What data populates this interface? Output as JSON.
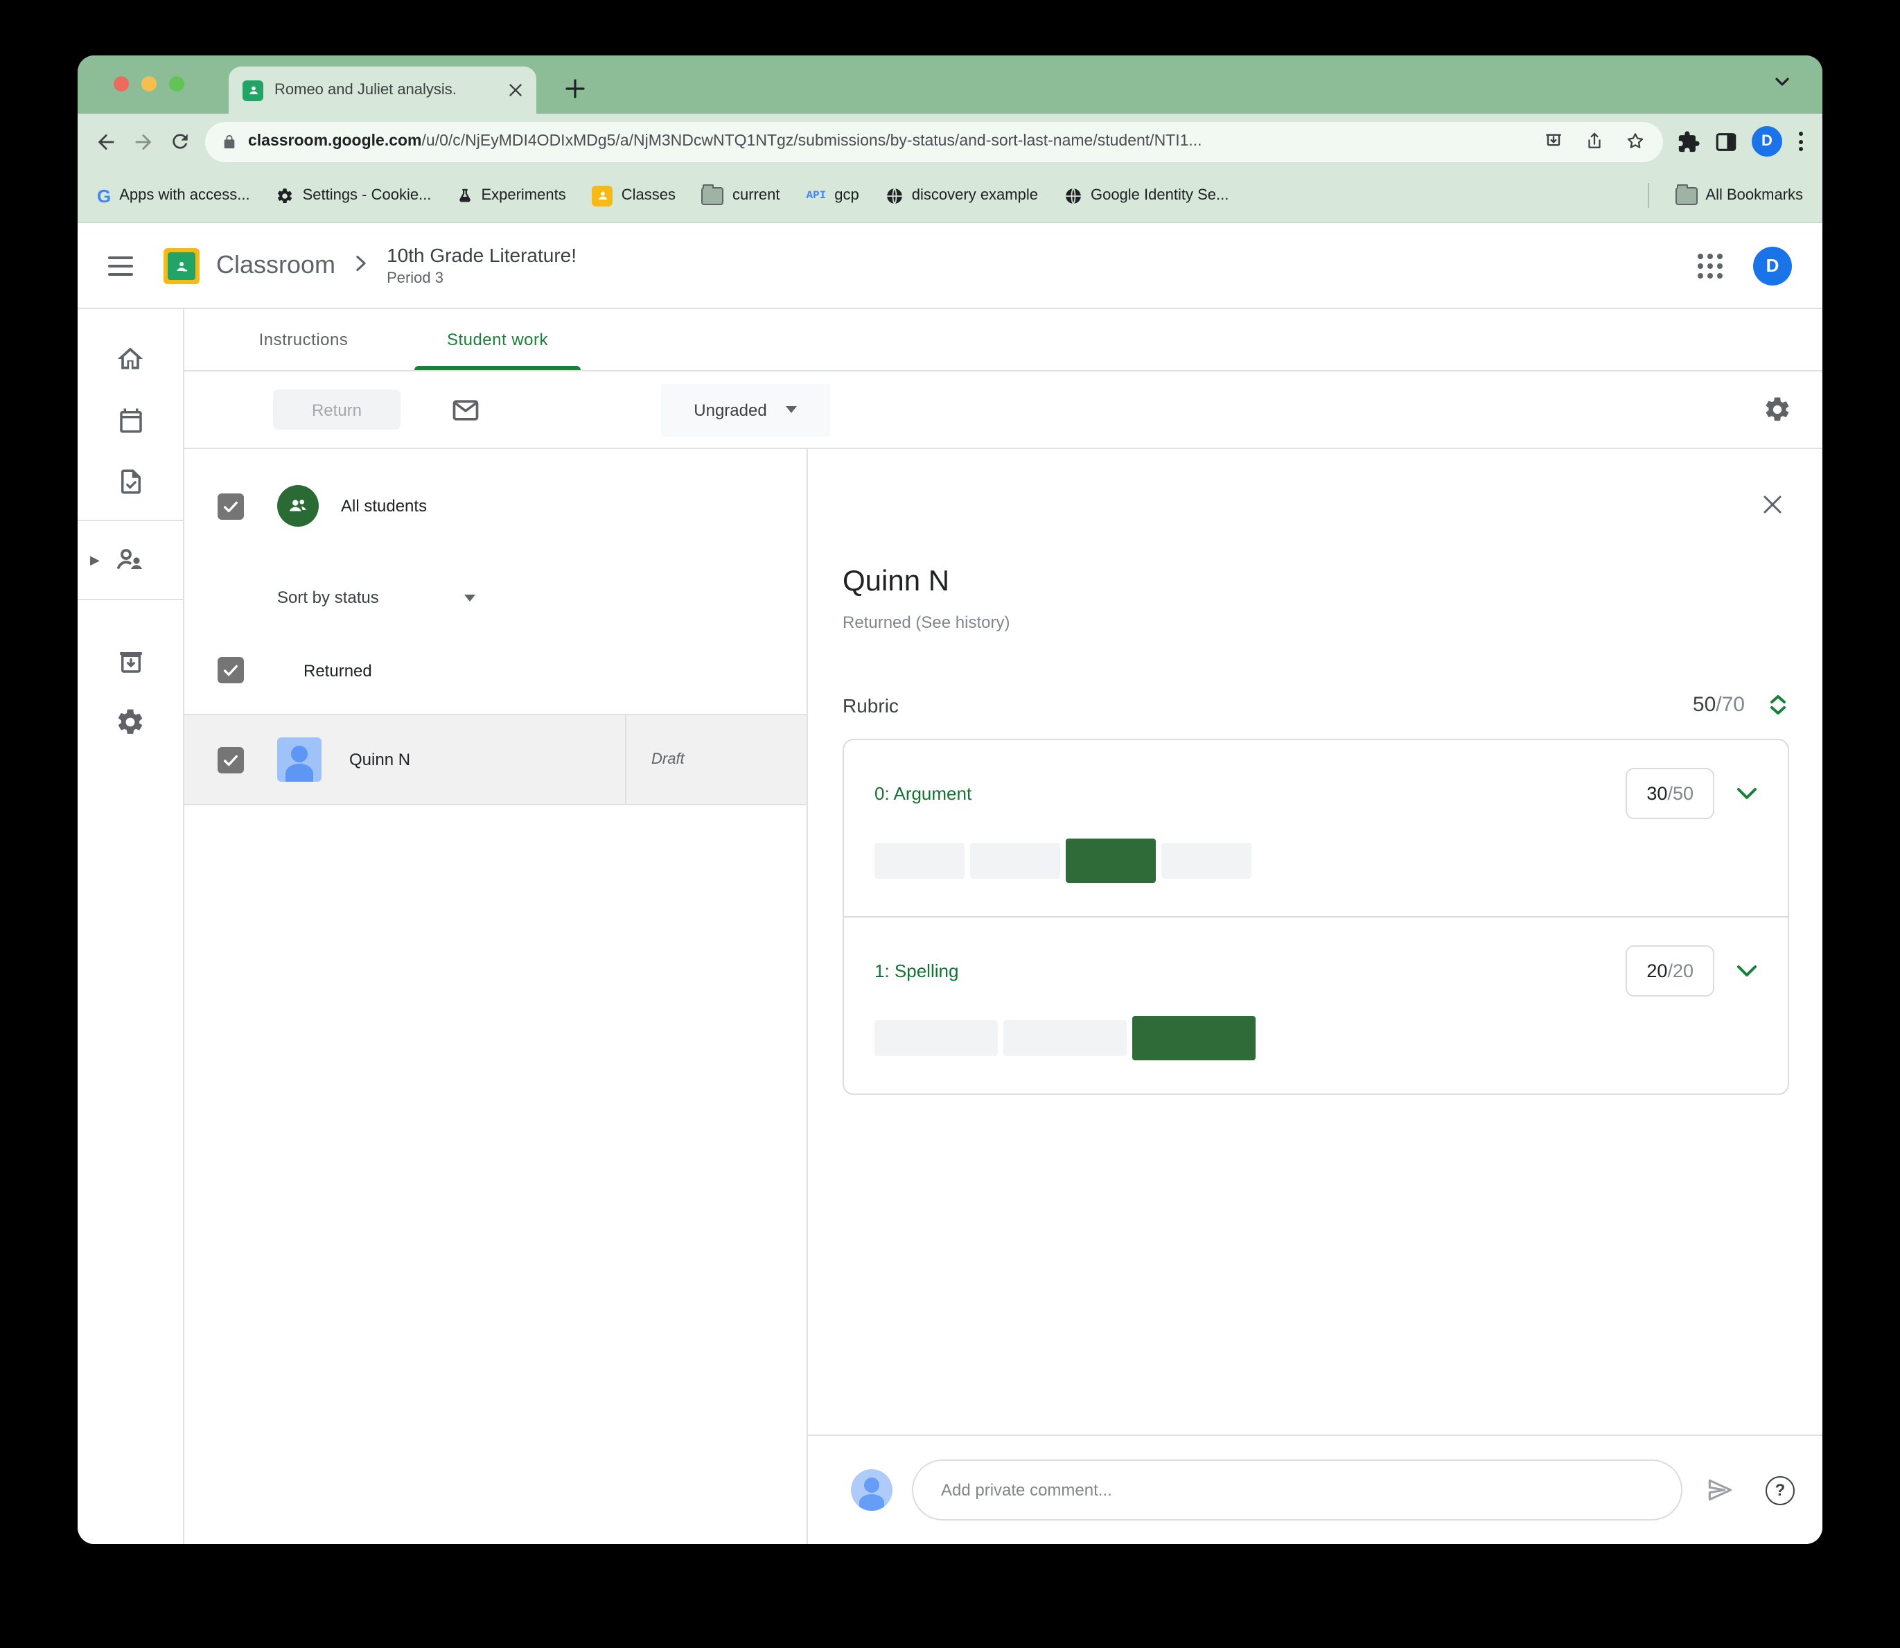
{
  "browser": {
    "tab_title": "Romeo and Juliet analysis.",
    "url_domain": "classroom.google.com",
    "url_path": "/u/0/c/NjEyMDI4ODIxMDg5/a/NjM3NDcwNTQ1NTgz/submissions/by-status/and-sort-last-name/student/NTI1...",
    "profile_initial": "D",
    "bookmarks": {
      "items": [
        {
          "label": "Apps with access..."
        },
        {
          "label": "Settings - Cookie..."
        },
        {
          "label": "Experiments"
        },
        {
          "label": "Classes"
        },
        {
          "label": "current"
        },
        {
          "label": "gcp",
          "badge": "API"
        },
        {
          "label": "discovery example"
        },
        {
          "label": "Google Identity Se..."
        }
      ],
      "all_bookmarks_label": "All Bookmarks"
    }
  },
  "header": {
    "product_name": "Classroom",
    "course_title": "10th Grade Literature!",
    "course_section": "Period 3",
    "profile_initial": "D"
  },
  "work_tabs": {
    "instructions_label": "Instructions",
    "student_work_label": "Student work"
  },
  "toolbar": {
    "return_label": "Return",
    "grade_filter_value": "Ungraded"
  },
  "student_list": {
    "all_students_label": "All students",
    "sort_value": "Sort by status",
    "group_label": "Returned",
    "rows": [
      {
        "name": "Quinn N",
        "work_state": "Draft"
      }
    ]
  },
  "detail": {
    "student_name": "Quinn N",
    "status_line": "Returned (See history)",
    "rubric_label": "Rubric",
    "total_score": "50",
    "total_denominator": "/70",
    "criteria": [
      {
        "title": "0: Argument",
        "score": "30",
        "denominator": "/50",
        "levels": 4,
        "selected_level_index": 2
      },
      {
        "title": "1: Spelling",
        "score": "20",
        "denominator": "/20",
        "levels": 3,
        "selected_level_index": 2
      }
    ],
    "comment_placeholder": "Add private comment..."
  },
  "colors": {
    "accent_green": "#188038",
    "selected_level_green": "#2e6b39",
    "chrome_green": "#8dbd97",
    "chrome_light_green": "#d7e7da",
    "profile_blue": "#1a73e8"
  }
}
